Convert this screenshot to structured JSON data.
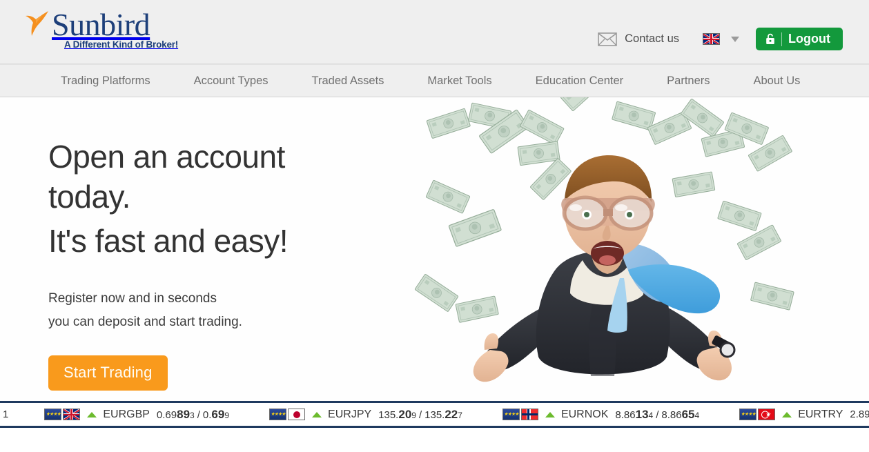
{
  "brand": {
    "name": "Sunbird",
    "tagline": "A Different Kind of Broker!",
    "logo_icon": "sunbird-icon",
    "navy": "#1d3f7a",
    "orange": "#f5901f"
  },
  "header": {
    "mail_icon": "envelope-icon",
    "contact_label": "Contact us",
    "language_flag": "uk-flag",
    "language_chevron": "chevron-down-icon",
    "logout_label": "Logout",
    "logout_icon": "unlock-icon",
    "logout_color": "#13993c"
  },
  "nav": {
    "items": [
      {
        "label": "Trading Platforms"
      },
      {
        "label": "Account Types"
      },
      {
        "label": "Traded Assets"
      },
      {
        "label": "Market Tools"
      },
      {
        "label": "Education Center"
      },
      {
        "label": "Partners"
      },
      {
        "label": "About Us"
      }
    ]
  },
  "hero": {
    "headline_line1": "Open an account",
    "headline_line2": "today.",
    "headline_line3": "It's fast and easy!",
    "sub_line1": "Register now and in seconds",
    "sub_line2": "you can deposit and start trading.",
    "cta_label": "Start Trading",
    "cta_color": "#f99a1c",
    "image_alt": "skydiving-businessman-with-falling-dollars"
  },
  "ticker": {
    "clipped_left_text": "1",
    "border_color": "#1f3a5f",
    "up_arrow_color": "#6cbb2e",
    "quotes": [
      {
        "base_flag": "eu-flag",
        "quote_flag": "uk-flag",
        "direction": "up",
        "symbol": "EURGBP",
        "bid_lead": "0.69",
        "bid_big": "89",
        "bid_small": "3",
        "separator": "/",
        "ask_lead": "0.",
        "ask_big": "69",
        "ask_small": "9"
      },
      {
        "base_flag": "eu-flag",
        "quote_flag": "jp-flag",
        "direction": "up",
        "symbol": "EURJPY",
        "bid_lead": "135.",
        "bid_big": "20",
        "bid_small": "9",
        "separator": "/",
        "ask_lead": "135.",
        "ask_big": "22",
        "ask_small": "7"
      },
      {
        "base_flag": "eu-flag",
        "quote_flag": "no-flag",
        "direction": "up",
        "symbol": "EURNOK",
        "bid_lead": "8.86",
        "bid_big": "13",
        "bid_small": "4",
        "separator": "/",
        "ask_lead": "8.86",
        "ask_big": "65",
        "ask_small": "4"
      },
      {
        "base_flag": "eu-flag",
        "quote_flag": "tr-flag",
        "direction": "up",
        "symbol": "EURTRY",
        "bid_lead": "2.89",
        "bid_big": "",
        "bid_small": "",
        "separator": "",
        "ask_lead": "",
        "ask_big": "",
        "ask_small": ""
      }
    ]
  }
}
